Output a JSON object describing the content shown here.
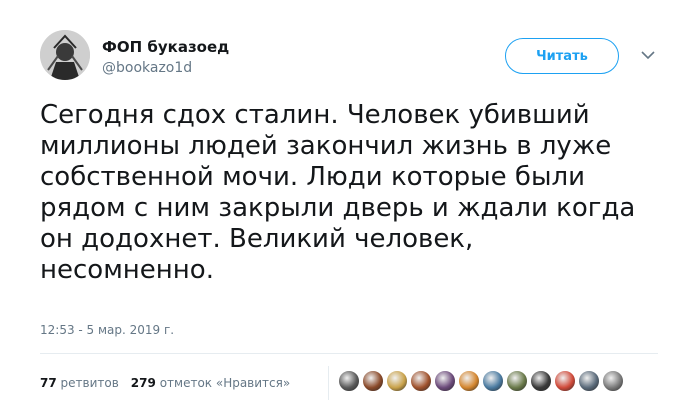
{
  "user": {
    "display_name": "ФОП буказоед",
    "handle": "@bookazo1d"
  },
  "follow_button": {
    "label": "Читать"
  },
  "tweet": {
    "text": "Сегодня сдох сталин. Человек убивший\nмиллионы людей закончил жизнь в луже\nсобственной мочи. Люди которые были\nрядом с ним закрыли дверь и ждали когда\nон додохнет. Великий человек,\nнесомненно.",
    "timestamp": "12:53 - 5 мар. 2019 г."
  },
  "stats": {
    "retweets_count": "77",
    "retweets_label": "ретвитов",
    "likes_count": "279",
    "likes_label": "отметок «Нравится»"
  },
  "colors": {
    "accent": "#1da1f2",
    "secondary_text": "#657786",
    "divider": "#e6ecf0"
  },
  "likers": [
    {
      "color": "#5a5a5a"
    },
    {
      "color": "#8a4a2a"
    },
    {
      "color": "#c9a24a"
    },
    {
      "color": "#a0522d"
    },
    {
      "color": "#6b4a7a"
    },
    {
      "color": "#d4862f"
    },
    {
      "color": "#4a7aa0"
    },
    {
      "color": "#6a7a4a"
    },
    {
      "color": "#3a3a3a"
    },
    {
      "color": "#d04a3a"
    },
    {
      "color": "#5a6a7a"
    },
    {
      "color": "#7a7a7a"
    }
  ]
}
